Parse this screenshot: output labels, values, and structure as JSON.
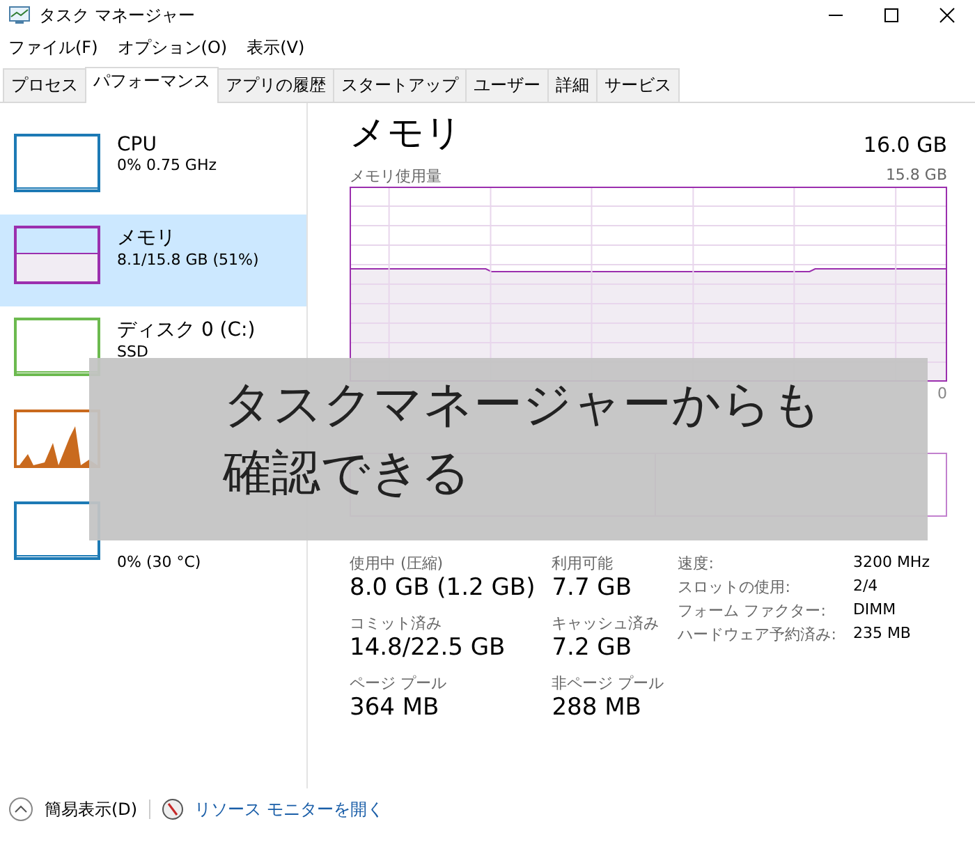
{
  "window": {
    "title": "タスク マネージャー"
  },
  "menu": [
    "ファイル(F)",
    "オプション(O)",
    "表示(V)"
  ],
  "tabs": [
    {
      "label": "プロセス",
      "selected": false
    },
    {
      "label": "パフォーマンス",
      "selected": true
    },
    {
      "label": "アプリの履歴",
      "selected": false
    },
    {
      "label": "スタートアップ",
      "selected": false
    },
    {
      "label": "ユーザー",
      "selected": false
    },
    {
      "label": "詳細",
      "selected": false
    },
    {
      "label": "サービス",
      "selected": false
    }
  ],
  "sidebar": {
    "items": [
      {
        "name": "CPU",
        "details": [
          "0% 0.75 GHz"
        ],
        "color": "#1d7ab5",
        "kind": "flat",
        "selected": false
      },
      {
        "name": "メモリ",
        "details": [
          "8.1/15.8 GB (51%)"
        ],
        "color": "#9b2fae",
        "kind": "filled",
        "selected": true
      },
      {
        "name": "ディスク 0 (C:)",
        "details": [
          "SSD"
        ],
        "color": "#6cba4f",
        "kind": "flat",
        "selected": false
      },
      {
        "color": "#c96a1e",
        "kind": "spikes",
        "selected": false
      },
      {
        "details": [
          "0% (30 °C)"
        ],
        "color": "#1d7ab5",
        "kind": "flat",
        "selected": false
      }
    ]
  },
  "detail": {
    "title": "メモリ",
    "total": "16.0 GB",
    "graph_label": "メモリ使用量",
    "graph_max": "15.8 GB",
    "graph_min": "0",
    "stats": [
      {
        "label": "使用中 (圧縮)",
        "value": "8.0 GB (1.2 GB)"
      },
      {
        "label": "利用可能",
        "value": "7.7 GB"
      },
      {
        "label": "コミット済み",
        "value": "14.8/22.5 GB"
      },
      {
        "label": "キャッシュ済み",
        "value": "7.2 GB"
      },
      {
        "label": "ページ プール",
        "value": "364 MB"
      },
      {
        "label": "非ページ プール",
        "value": "288 MB"
      }
    ],
    "specs": [
      {
        "label": "速度:",
        "value": "3200 MHz"
      },
      {
        "label": "スロットの使用:",
        "value": "2/4"
      },
      {
        "label": "フォーム ファクター:",
        "value": "DIMM"
      },
      {
        "label": "ハードウェア予約済み:",
        "value": "235 MB"
      }
    ]
  },
  "footer": {
    "fewer_details": "簡易表示(D)",
    "resource_monitor": "リソース モニターを開く"
  },
  "caption": [
    "タスクマネージャーからも",
    "確認できる"
  ]
}
